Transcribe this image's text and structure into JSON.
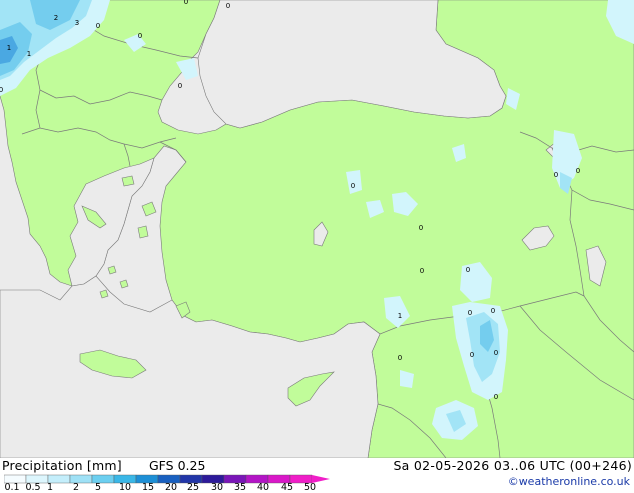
{
  "map": {
    "colors": {
      "sea": "#ebebeb",
      "land": "#c1fc9a",
      "border": "#7a7a7a",
      "rain_light": "#d2f5fc",
      "rain_mid": "#a2e4f6",
      "rain_heavy": "#74cdee",
      "rain_strong": "#4aa8e2"
    },
    "contour_labels": [
      "2",
      "3",
      "1",
      "1",
      "0",
      "0",
      "0",
      "0",
      "0",
      "0",
      "0",
      "0",
      "0",
      "0",
      "0",
      "1",
      "0",
      "0",
      "0",
      "0",
      "0",
      "0",
      "0"
    ]
  },
  "footer": {
    "title": "Precipitation [mm]",
    "model": "GFS 0.25",
    "datetime": "Sa 02-05-2026 03..06 UTC (00+246)",
    "credit": "©weatheronline.co.uk"
  },
  "legend": {
    "ticks": [
      "0.1",
      "0.5",
      "1",
      "2",
      "5",
      "10",
      "15",
      "20",
      "25",
      "30",
      "35",
      "40",
      "45",
      "50"
    ],
    "colors": [
      "#f5fcff",
      "#ddf6fd",
      "#c4eefb",
      "#9fe1f6",
      "#6ccff0",
      "#3ab7e7",
      "#1d8fd6",
      "#1960c0",
      "#2236a8",
      "#2d1a9a",
      "#7a16b8",
      "#b315c6",
      "#d918c8",
      "#f01ec8"
    ]
  }
}
